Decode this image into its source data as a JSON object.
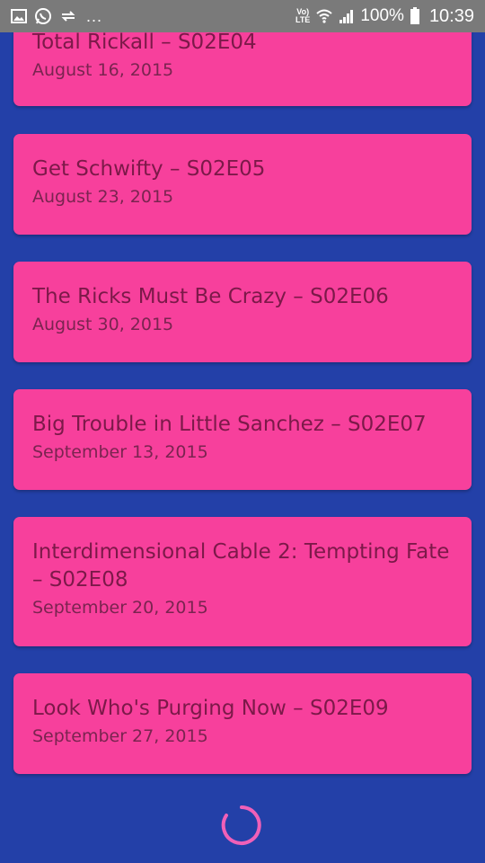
{
  "status_bar": {
    "more": "...",
    "volte_top": "Vo)",
    "volte_bottom": "LTE",
    "battery": "100%",
    "time": "10:39",
    "icons": [
      "image-icon",
      "whatsapp-icon",
      "sync-icon",
      "wifi-icon",
      "signal-icon",
      "battery-icon"
    ]
  },
  "episodes": [
    {
      "title": "Total Rickall – S02E04",
      "date": "August 16, 2015"
    },
    {
      "title": "Get Schwifty – S02E05",
      "date": "August 23, 2015"
    },
    {
      "title": "The Ricks Must Be Crazy – S02E06",
      "date": "August 30, 2015"
    },
    {
      "title": "Big Trouble in Little Sanchez – S02E07",
      "date": "September 13, 2015"
    },
    {
      "title": "Interdimensional Cable 2: Tempting Fate – S02E08",
      "date": "September 20, 2015"
    },
    {
      "title": "Look Who's Purging Now – S02E09",
      "date": "September 27, 2015"
    }
  ],
  "colors": {
    "background": "#2340a8",
    "card": "#f7409c",
    "card_text": "#7c1949",
    "spinner": "#f060b8"
  },
  "loading_icon": "loading-spinner-icon"
}
